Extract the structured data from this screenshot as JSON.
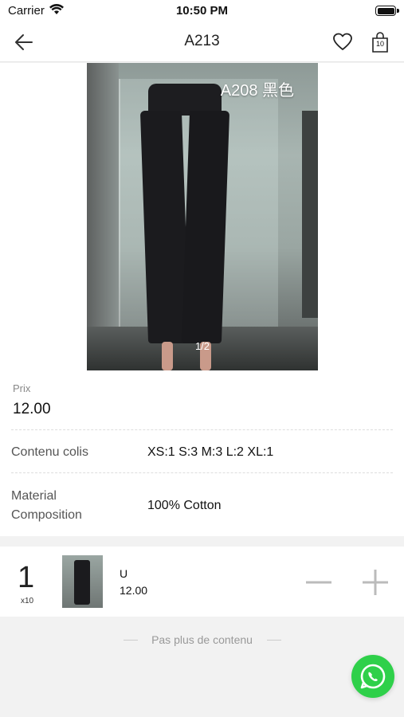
{
  "status_bar": {
    "carrier": "Carrier",
    "time": "10:50 PM",
    "icons": [
      "wifi-icon",
      "battery-icon"
    ]
  },
  "nav": {
    "title": "A213",
    "back_icon": "arrow-left-icon",
    "favorite_icon": "heart-icon",
    "cart_icon": "shopping-bag-icon",
    "cart_count": "10"
  },
  "gallery": {
    "caption": "A208 黑色",
    "page_indicator": "1/2"
  },
  "product": {
    "price_label": "Prix",
    "price": "12.00",
    "package_label": "Contenu colis",
    "package_value": "XS:1 S:3 M:3 L:2 XL:1",
    "material_label_line1": "Material",
    "material_label_line2": "Composition",
    "material_value": "100% Cotton"
  },
  "cart_item": {
    "quantity": "1",
    "multiplier": "x10",
    "size": "U",
    "price": "12.00",
    "minus_icon": "minus-icon",
    "plus_icon": "plus-icon"
  },
  "footer": {
    "end_text": "Pas plus de contenu"
  },
  "whatsapp": {
    "icon": "whatsapp-icon",
    "color": "#2fd04a"
  }
}
